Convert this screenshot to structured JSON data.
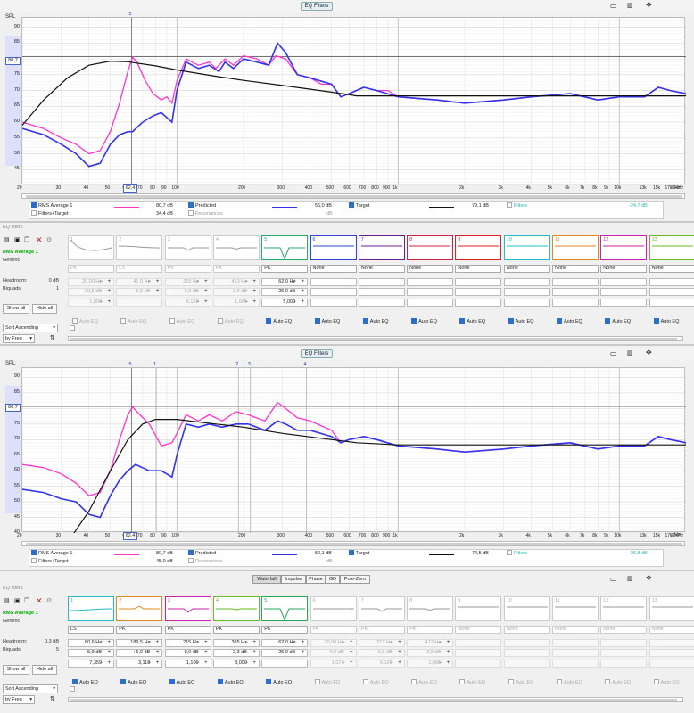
{
  "toolbar_label": "EQ Filters",
  "spl_label": "SPL",
  "cursor_level": "80,7",
  "cursor_freq": "62,4",
  "hz_label": "Hz",
  "xaxis_ticks": [
    "20",
    "30",
    "40",
    "50",
    "60",
    "70",
    "80",
    "90",
    "100",
    "200",
    "300",
    "400",
    "500",
    "600",
    "700",
    "800",
    "900",
    "1k",
    "2k",
    "3k",
    "4k",
    "5k",
    "6k",
    "7k",
    "8k",
    "9k",
    "10k",
    "13k",
    "15k",
    "17k",
    "20kHz"
  ],
  "colors": {
    "rms": "#ff33cc",
    "predicted": "#3333ee",
    "target": "#111111",
    "filters": "#22bbbb",
    "cursor": "#cc3333",
    "band": "#dde0f8"
  },
  "top": {
    "yaxis_ticks": [
      "90",
      "85",
      "75",
      "70",
      "65",
      "60",
      "55",
      "50",
      "45"
    ],
    "marker_labels": [
      "5"
    ],
    "legend": {
      "rms_name": "RMS Average 1",
      "rms_val": "80,7 dB",
      "ft_name": "Filters+Target",
      "ft_val": "34,4 dB",
      "pred_name": "Predicted",
      "pred_val": "56,0 dB",
      "res_name": "Resonances",
      "res_val": "dB",
      "target_name": "Target",
      "target_val": "79,1 dB",
      "filters_name": "Filters",
      "filters_val": "-24,7 dB"
    },
    "panel": {
      "header": "EQ filters",
      "measure": "RMS Average 1",
      "generic": "Generic",
      "headroom_lbl": "Headroom:",
      "headroom": "0 dB",
      "biquads_lbl": "Biquads:",
      "biquads": "1",
      "show_all": "Show all",
      "hide_all": "Hide all",
      "sort": "Sort Ascending",
      "by": "by Freq",
      "filters": [
        {
          "n": "1",
          "type": "PK",
          "f": "20,00 Hz",
          "g": "-20,5 dB",
          "q": "1,000",
          "active": false
        },
        {
          "n": "2",
          "type": "LS",
          "f": "41,0 Hz",
          "g": "-5,9 dB",
          "q": "",
          "active": false
        },
        {
          "n": "3",
          "type": "PK",
          "f": "215 Hz",
          "g": "-6,9 dB",
          "q": "6,129",
          "active": false
        },
        {
          "n": "4",
          "type": "PK",
          "f": "413 Hz",
          "g": "-3,9 dB",
          "q": "1,665",
          "active": false
        },
        {
          "n": "5",
          "type": "PK",
          "f": "62,0 Hz",
          "g": "-25,0 dB",
          "q": "5,000",
          "active": true
        },
        {
          "n": "6",
          "type": "None",
          "f": "",
          "g": "",
          "q": "",
          "active": true
        },
        {
          "n": "7",
          "type": "None",
          "f": "",
          "g": "",
          "q": "",
          "active": true
        },
        {
          "n": "8",
          "type": "None",
          "f": "",
          "g": "",
          "q": "",
          "active": true
        },
        {
          "n": "9",
          "type": "None",
          "f": "",
          "g": "",
          "q": "",
          "active": true
        },
        {
          "n": "10",
          "type": "None",
          "f": "",
          "g": "",
          "q": "",
          "active": true
        },
        {
          "n": "11",
          "type": "None",
          "f": "",
          "g": "",
          "q": "",
          "active": true
        },
        {
          "n": "12",
          "type": "None",
          "f": "",
          "g": "",
          "q": "",
          "active": true
        },
        {
          "n": "13",
          "type": "None",
          "f": "",
          "g": "",
          "q": "",
          "active": true
        }
      ],
      "autoeq": "Auto EQ"
    }
  },
  "bottom": {
    "yaxis_ticks": [
      "90",
      "85",
      "75",
      "70",
      "65",
      "60",
      "55",
      "50",
      "45",
      "40"
    ],
    "marker_labels": [
      "5",
      "1",
      "2",
      "3",
      "4"
    ],
    "legend": {
      "rms_name": "RMS Average 1",
      "rms_val": "80,7 dB",
      "ft_name": "Filters+Target",
      "ft_val": "45,0 dB",
      "pred_name": "Predicted",
      "pred_val": "52,1 dB",
      "res_name": "Resonances",
      "res_val": "dB",
      "target_name": "Target",
      "target_val": "74,5 dB",
      "filters_name": "Filters",
      "filters_val": "-26,8 dB"
    },
    "tabs": [
      "Waterfall",
      "Impulse",
      "Phase",
      "GD",
      "Pole-Zero"
    ],
    "panel": {
      "header": "EQ filters",
      "measure": "RMS Average 1",
      "generic": "Generic",
      "headroom_lbl": "Headroom:",
      "headroom": "0,3 dB",
      "biquads_lbl": "Biquads:",
      "biquads": "5",
      "show_all": "Show all",
      "hide_all": "Hide all",
      "sort": "Sort Ascending",
      "by": "by Freq",
      "filters": [
        {
          "n": "1",
          "type": "LS",
          "f": "80,6 Hz",
          "g": "-5,9 dB",
          "q": "7,359",
          "active": true
        },
        {
          "n": "2",
          "type": "PK",
          "f": "189,5 Hz",
          "g": "+6,0 dB",
          "q": "3,118",
          "active": true
        },
        {
          "n": "3",
          "type": "PK",
          "f": "215 Hz",
          "g": "-8,0 dB",
          "q": "1,100",
          "active": true
        },
        {
          "n": "4",
          "type": "PK",
          "f": "385 Hz",
          "g": "-2,3 dB",
          "q": "8,000",
          "active": true
        },
        {
          "n": "5",
          "type": "PK",
          "f": "62,0 Hz",
          "g": "-25,0 dB",
          "q": "",
          "active": true
        },
        {
          "n": "6",
          "type": "PK",
          "f": "20,00 Hz",
          "g": "0,0 dB",
          "q": "1,071",
          "active": false
        },
        {
          "n": "7",
          "type": "PK",
          "f": "213 Hz",
          "g": "-6,5 dB",
          "q": "6,129",
          "active": false
        },
        {
          "n": "8",
          "type": "PK",
          "f": "413 Hz",
          "g": "-3,9 dB",
          "q": "1,665",
          "active": false
        },
        {
          "n": "9",
          "type": "None",
          "f": "",
          "g": "",
          "q": "",
          "active": false
        },
        {
          "n": "10",
          "type": "None",
          "f": "",
          "g": "",
          "q": "",
          "active": false
        },
        {
          "n": "11",
          "type": "None",
          "f": "",
          "g": "",
          "q": "",
          "active": false
        },
        {
          "n": "12",
          "type": "None",
          "f": "",
          "g": "",
          "q": "",
          "active": false
        },
        {
          "n": "13",
          "type": "None",
          "f": "",
          "g": "",
          "q": "",
          "active": false
        }
      ],
      "autoeq": "Auto EQ"
    }
  }
}
